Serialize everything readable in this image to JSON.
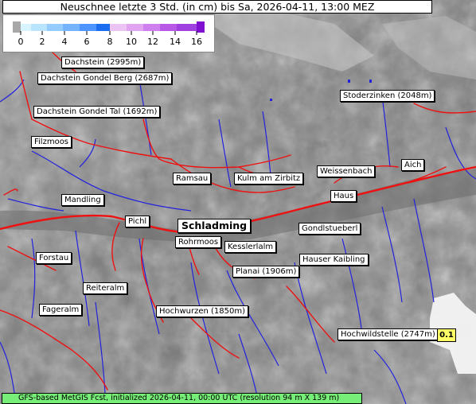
{
  "title": "Neuschnee letzte 3 Std. (in cm) bis Sa, 2026-04-11, 13:00 MEZ",
  "legend": {
    "ticks": [
      "0",
      "2",
      "4",
      "6",
      "8",
      "10",
      "12",
      "14",
      "16"
    ],
    "colors": [
      "#c8c8c8",
      "#d8f4ff",
      "#a8d8ff",
      "#7cb8ff",
      "#4c94ff",
      "#1c6cf0",
      "#e6b4f0",
      "#d890ee",
      "#c068ee",
      "#a040e0",
      "#8010d0"
    ]
  },
  "places": [
    {
      "name": "Dachstein (2995m)"
    },
    {
      "name": "Dachstein Gondel Berg (2687m)"
    },
    {
      "name": "Dachstein Gondel Tal (1692m)"
    },
    {
      "name": "Filzmoos"
    },
    {
      "name": "Stoderzinken (2048m)"
    },
    {
      "name": "Ramsau"
    },
    {
      "name": "Kulm am Zirbitz"
    },
    {
      "name": "Weissenbach"
    },
    {
      "name": "Aich"
    },
    {
      "name": "Mandling"
    },
    {
      "name": "Haus"
    },
    {
      "name": "Pichl"
    },
    {
      "name": "Schladming"
    },
    {
      "name": "Gondlstueberl"
    },
    {
      "name": "Rohrmoos"
    },
    {
      "name": "Kesslerlalm"
    },
    {
      "name": "Forstau"
    },
    {
      "name": "Hauser Kaibling"
    },
    {
      "name": "Planai (1906m)"
    },
    {
      "name": "Reiteralm"
    },
    {
      "name": "Fageralm"
    },
    {
      "name": "Hochwurzen (1850m)"
    },
    {
      "name": "Hochwildstelle (2747m)"
    }
  ],
  "value_badge": "0.1",
  "footer": "GFS-based MetGIS Fcst, initialized 2026-04-11, 00:00 UTC  (resolution 94 m X 139 m)",
  "colors": {
    "roads": "#ee1111",
    "rivers": "#2222dd",
    "footer": "#77ee77",
    "badge": "#ffff66"
  }
}
